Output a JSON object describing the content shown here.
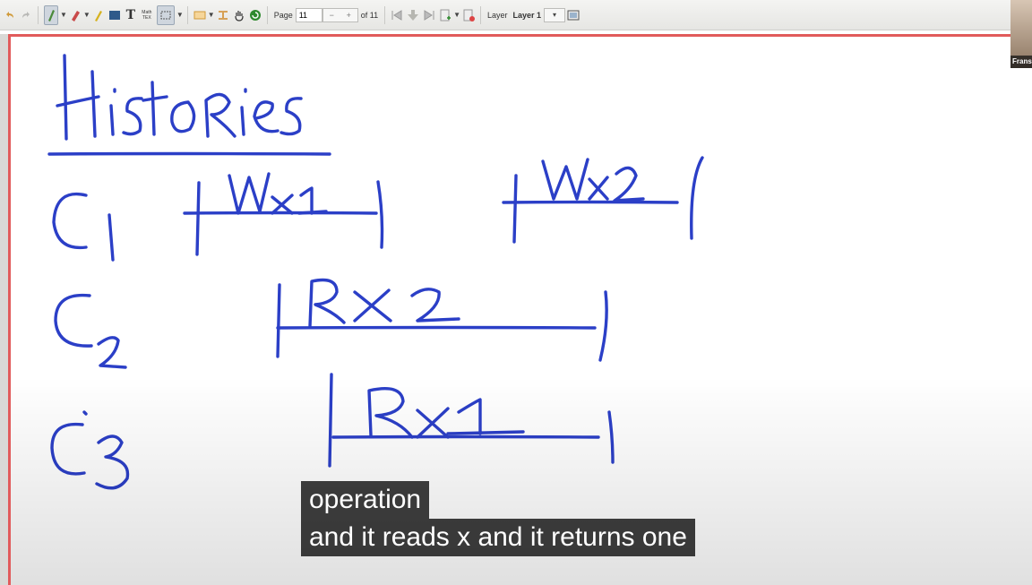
{
  "toolbar": {
    "tex_label": "Math TEX",
    "text_tool_label": "T",
    "page_label": "Page",
    "page_current": "11",
    "page_total": "of 11",
    "layer_label": "Layer",
    "layer_current": "Layer 1",
    "stepper_minus": "−",
    "stepper_plus": "+"
  },
  "webcam": {
    "name_label": "Frans"
  },
  "whiteboard": {
    "heading": "Histories",
    "clients": [
      "C1",
      "C2",
      "C3"
    ],
    "operations": [
      {
        "client": "C1",
        "label": "Wx1"
      },
      {
        "client": "C1",
        "label": "Wx2"
      },
      {
        "client": "C2",
        "label": "Rx2"
      },
      {
        "client": "C3",
        "label": "Rx1"
      }
    ],
    "ink_color": "#2b3fc7"
  },
  "captions": {
    "line1": "operation",
    "line2": "and it reads x and it returns one"
  },
  "colors": {
    "page_border": "#e15b5b",
    "ink": "#2b3fc7",
    "caption_bg": "#141414"
  }
}
